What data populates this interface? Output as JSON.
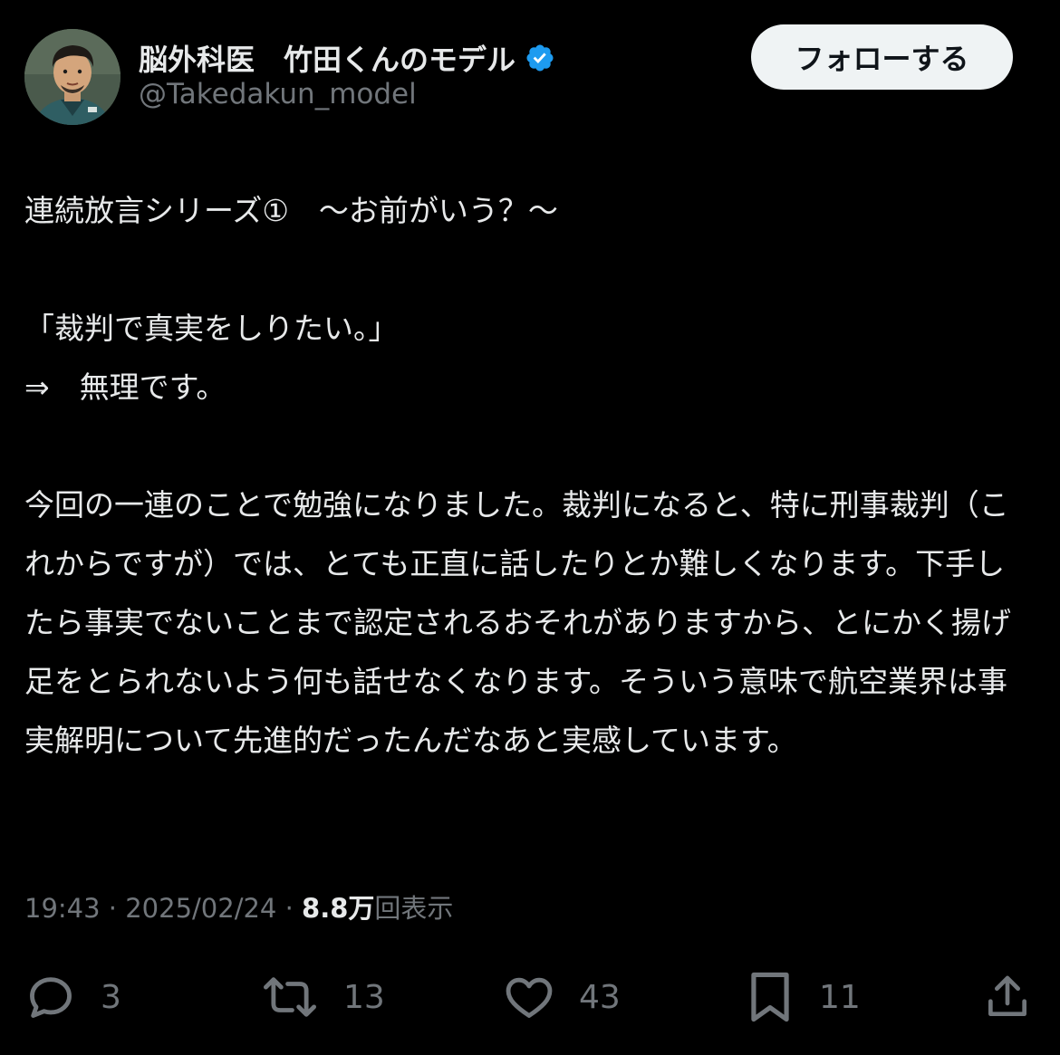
{
  "user": {
    "display_name": "脳外科医　竹田くんのモデル",
    "handle": "@Takedakun_model",
    "verified": true,
    "avatar_icon": "avatar-illustration"
  },
  "follow_button_label": "フォローする",
  "tweet": {
    "lines": [
      "連続放言シリーズ①　～お前がいう？～",
      "",
      "「裁判で真実をしりたい。」",
      "⇒　無理です。",
      "",
      "今回の一連のことで勉強になりました。裁判になると、特に刑事裁判（これからですが）では、とても正直に話したりとか難しくなります。下手したら事実でないことまで認定されるおそれがありますから、とにかく揚げ足をとられないよう何も話せなくなります。そういう意味で航空業界は事実解明について先進的だったんだなあと実感しています。"
    ]
  },
  "meta": {
    "time": "19:43",
    "separator": " · ",
    "date": "2025/02/24",
    "views_count": "8.8万",
    "views_label": "回表示"
  },
  "actions": {
    "replies": "3",
    "retweets": "13",
    "likes": "43",
    "bookmarks": "11"
  },
  "colors": {
    "background": "#000000",
    "text": "#e7e9ea",
    "secondary": "#71767b",
    "verified": "#1d9bf0",
    "button_bg": "#eff3f4"
  }
}
